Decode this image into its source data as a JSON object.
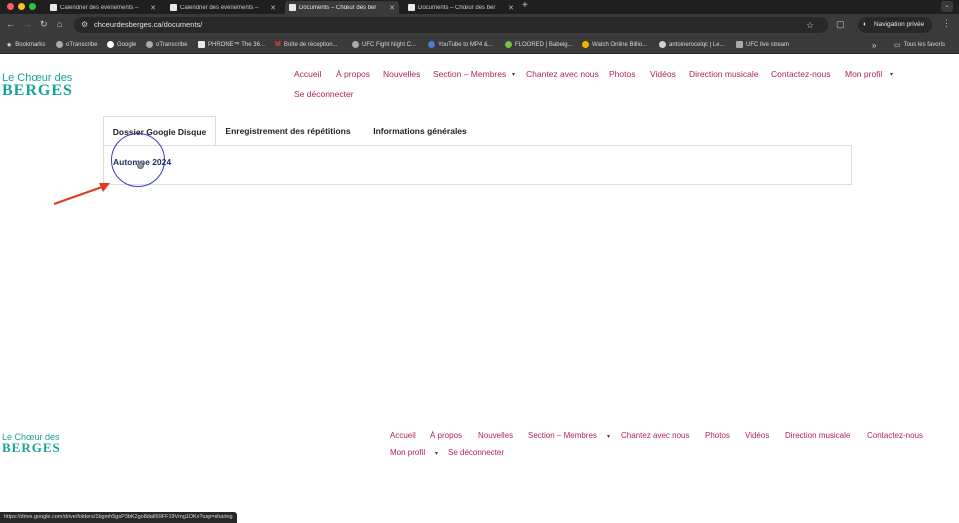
{
  "browser": {
    "tabs": [
      {
        "label": "Calendrier des événements –",
        "active": false
      },
      {
        "label": "Calendrier des événements –",
        "active": false
      },
      {
        "label": "Documents – Chœur des ber",
        "active": true
      },
      {
        "label": "Documents – Chœur des ber",
        "active": false
      }
    ],
    "new_tab": "+",
    "url": "chceurdesberges.ca/documents/",
    "incognito_label": "Navigation privée",
    "bookmarks": [
      {
        "label": "Bookmarks",
        "icon": "star-icon"
      },
      {
        "label": "oTranscribe",
        "icon": "globe-icon"
      },
      {
        "label": "Google",
        "icon": "google-icon"
      },
      {
        "label": "oTranscribe",
        "icon": "globe-icon"
      },
      {
        "label": "PHRONE™ The 36...",
        "icon": "bookmark-icon"
      },
      {
        "label": "Boîte de réception...",
        "icon": "gmail-icon"
      },
      {
        "label": "UFC Fight Night C...",
        "icon": "globe-icon"
      },
      {
        "label": "YouTube to MP4 &...",
        "icon": "globe-icon"
      },
      {
        "label": "FLOORED | Babeig...",
        "icon": "globe-icon"
      },
      {
        "label": "Watch Online Billio...",
        "icon": "globe-icon"
      },
      {
        "label": "antoinerocelqc | Le...",
        "icon": "wordpress-icon"
      },
      {
        "label": "UFC live stream",
        "icon": "globe-icon"
      }
    ],
    "bookmarks_overflow": "»",
    "all_bookmarks": "Tous les favoris",
    "status_url": "https://drive.google.com/drive/folders/1bgmh5gsP3bK2go8dalI69FF19Vmg1DKx?usp=sharing"
  },
  "logo": {
    "line1": "Le Chœur des",
    "line2": "BERGES"
  },
  "nav": {
    "items": [
      "Accueil",
      "À propos",
      "Nouvelles",
      "Section – Membres",
      "Chantez avec nous",
      "Photos",
      "Vidéos",
      "Direction musicale",
      "Contactez-nous",
      "Mon profil",
      "Se déconnecter"
    ],
    "caret": "▾"
  },
  "doc_tabs": [
    "Dossier Google Disque",
    "Enregistrement des répétitions",
    "Informations générales"
  ],
  "panel": {
    "folder_link": "Automne 2024"
  },
  "footer": {
    "logo_line1": "Le Chœur des",
    "logo_line2": "BERGES",
    "items": [
      "Accueil",
      "À propos",
      "Nouvelles",
      "Section – Membres",
      "Chantez avec nous",
      "Photos",
      "Vidéos",
      "Direction musicale",
      "Contactez-nous",
      "Mon profil",
      "Se déconnecter"
    ]
  },
  "colors": {
    "accent": "#b0245a",
    "brand": "#15a39a",
    "annotation_circle": "#3838d0",
    "annotation_arrow": "#e03a1e"
  }
}
